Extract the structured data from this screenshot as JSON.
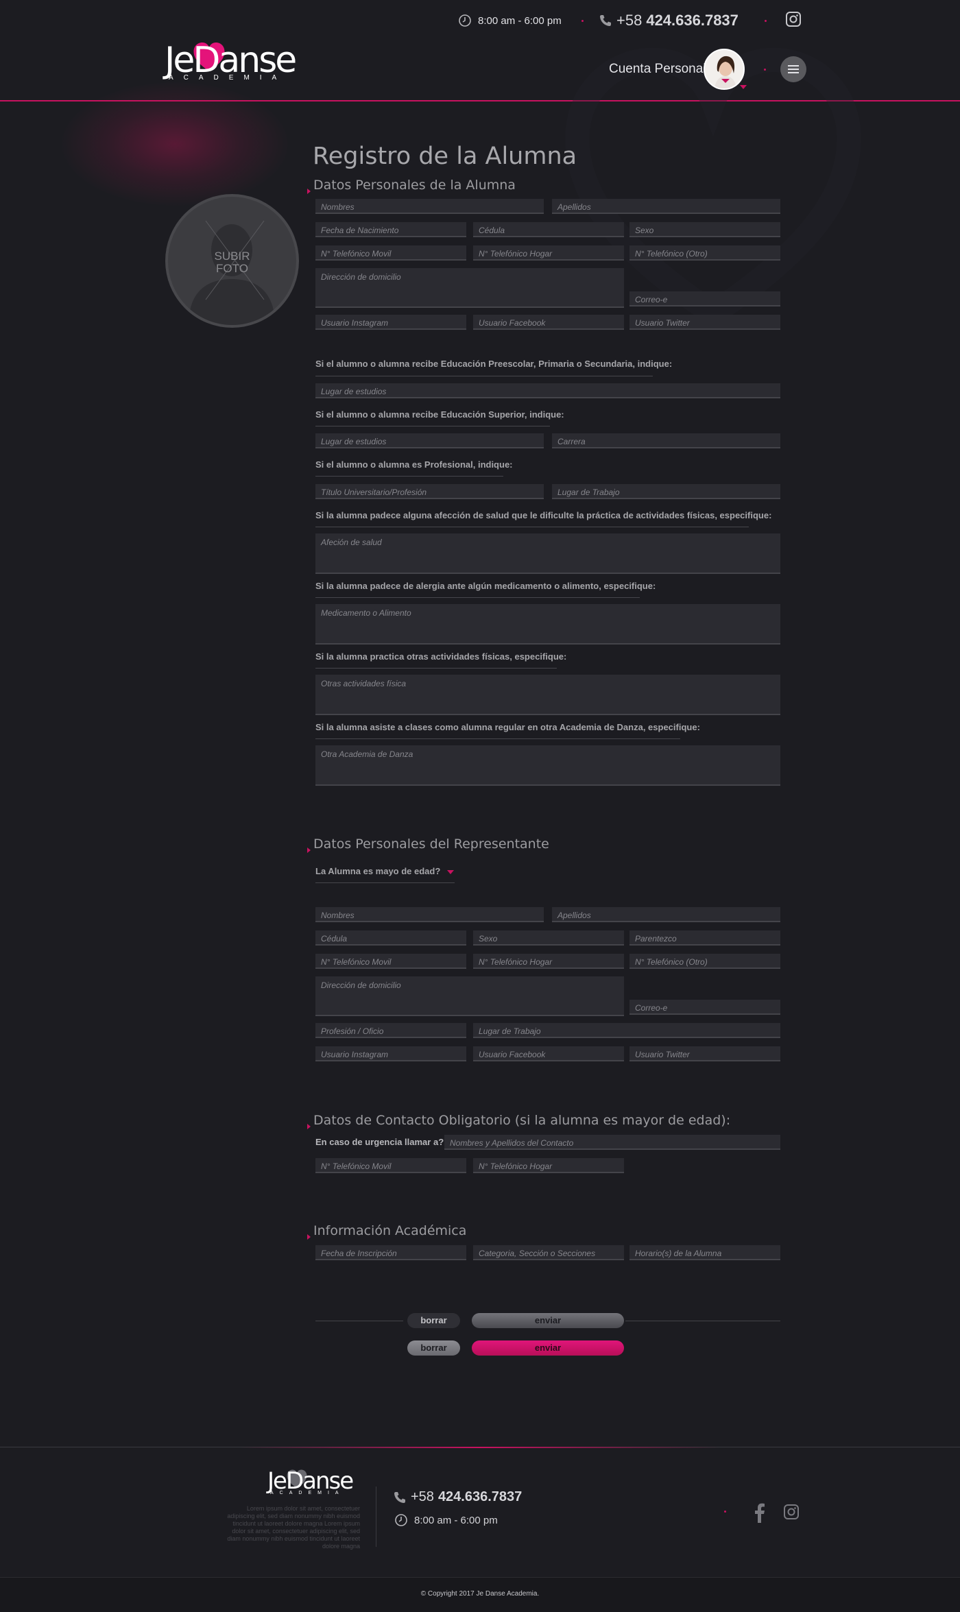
{
  "header": {
    "hours": "8:00 am - 6:00 pm",
    "phone_prefix": "+58",
    "phone_number": "424.636.7837",
    "logo_text": "JeDanse",
    "logo_sub": "ACADEMIA",
    "account_label": "Cuenta Personal"
  },
  "photo": {
    "label_line1": "SUBIR",
    "label_line2": "FOTO"
  },
  "page_title": "Registro de la Alumna",
  "student": {
    "section_title": "Datos Personales de la Alumna",
    "nombres": "Nombres",
    "apellidos": "Apellidos",
    "fecha_nacimiento": "Fecha de Nacimiento",
    "cedula": "Cédula",
    "sexo": "Sexo",
    "tel_movil": "N° Telefónico Movil",
    "tel_hogar": "N° Telefónico Hogar",
    "tel_otro": "N° Telefónico (Otro)",
    "direccion": "Dirección de domicilio",
    "correo": "Correo-e",
    "instagram": "Usuario Instagram",
    "facebook": "Usuario Facebook",
    "twitter": "Usuario Twitter",
    "q_escolar": "Si el alumno o alumna recibe Educación Preescolar, Primaria o Secundaria, indique:",
    "lugar_estudios_1": "Lugar de estudios",
    "q_superior": "Si el alumno o alumna recibe Educación Superior, indique:",
    "lugar_estudios_2": "Lugar de estudios",
    "carrera": "Carrera",
    "q_profesional": "Si el alumno o alumna es Profesional, indique:",
    "titulo": "Título Universitario/Profesión",
    "lugar_trabajo": "Lugar de Trabajo",
    "q_salud": "Si la alumna padece alguna afección de salud que le dificulte la práctica de actividades físicas, especifique:",
    "afeccion": "Afeción de salud",
    "q_alergia": "Si la alumna padece de alergia ante algún medicamento o alimento, especifique:",
    "medicamento": "Medicamento o Alimento",
    "q_actividades": "Si la alumna practica otras actividades físicas, especifique:",
    "otras_actividades": "Otras actividades física",
    "q_academia": "Si la alumna asiste a clases como alumna regular en otra Academia de Danza, especifique:",
    "otra_academia": "Otra Academia de Danza"
  },
  "representative": {
    "section_title": "Datos Personales del Representante",
    "mayor_edad_select": "La Alumna es mayo de edad?",
    "nombres": "Nombres",
    "apellidos": "Apellidos",
    "cedula": "Cédula",
    "sexo": "Sexo",
    "parentezco": "Parentezco",
    "tel_movil": "N° Telefónico Movil",
    "tel_hogar": "N° Telefónico Hogar",
    "tel_otro": "N° Telefónico (Otro)",
    "direccion": "Dirección de domicilio",
    "correo": "Correo-e",
    "profesion": "Profesión / Oficio",
    "lugar_trabajo": "Lugar de Trabajo",
    "instagram": "Usuario Instagram",
    "facebook": "Usuario Facebook",
    "twitter": "Usuario Twitter"
  },
  "contact": {
    "section_title": "Datos de Contacto Obligatorio (si la alumna es mayor de edad):",
    "urgencia_label": "En caso de urgencia llamar a?",
    "nombre_contacto": "Nombres y Apellidos del Contacto",
    "tel_movil": "N° Telefónico Movil",
    "tel_hogar": "N° Telefónico Hogar"
  },
  "academic": {
    "section_title": "Información Académica",
    "fecha_inscripcion": "Fecha de Inscripción",
    "categoria": "Categoria, Sección o Secciones",
    "horario": "Horario(s) de la Alumna"
  },
  "buttons": {
    "borrar": "borrar",
    "enviar": "enviar"
  },
  "footer": {
    "logo_text": "JeDanse",
    "logo_sub": "ACADEMIA",
    "lorem": "Lorem ipsum dolor sit amet, consectetuer adipiscing elit, sed diam nonummy nibh euismod tincidunt ut laoreet dolore magna Lorem ipsum dolor sit amet, consectetuer adipiscing elit, sed diam nonummy nibh euismod tincidunt ut laoreet dolore magna",
    "phone_prefix": "+58",
    "phone_number": "424.636.7837",
    "hours": "8:00 am - 6:00 pm",
    "copyright": "© Copyright 2017 Je Danse Academia."
  },
  "colors": {
    "accent": "#c8125f",
    "background": "#1c1c21",
    "field": "#2b2b31"
  },
  "icons": [
    "clock-icon",
    "phone-icon",
    "instagram-icon",
    "menu-icon",
    "user-silhouette-icon",
    "facebook-icon"
  ]
}
